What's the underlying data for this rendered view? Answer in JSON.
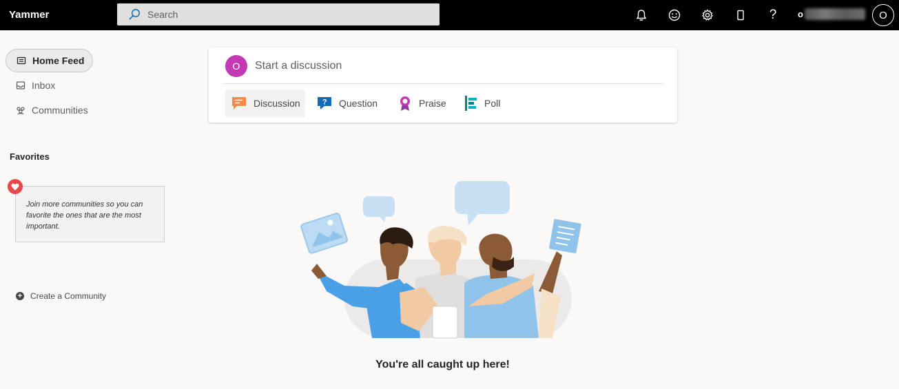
{
  "topbar": {
    "brand": "Yammer",
    "search_placeholder": "Search",
    "icons": [
      "bell-icon",
      "smiley-icon",
      "gear-icon",
      "phone-icon",
      "help-icon"
    ],
    "user_name_visible": "o",
    "avatar_initial": "O"
  },
  "nav": {
    "items": [
      {
        "label": "Home Feed",
        "icon": "home-feed-icon",
        "active": true
      },
      {
        "label": "Inbox",
        "icon": "inbox-icon",
        "active": false
      },
      {
        "label": "Communities",
        "icon": "communities-icon",
        "active": false
      }
    ],
    "favorites_title": "Favorites",
    "favorites_hint": "Join more communities so you can favorite the ones that are the most important.",
    "create_community": "Create a Community"
  },
  "publisher": {
    "avatar_initial": "O",
    "prompt": "Start a discussion",
    "tabs": [
      {
        "label": "Discussion",
        "icon": "discussion-icon",
        "color": "#f7894a",
        "selected": true
      },
      {
        "label": "Question",
        "icon": "question-icon",
        "color": "#0f6cbd"
      },
      {
        "label": "Praise",
        "icon": "praise-icon",
        "color": "#c239b3"
      },
      {
        "label": "Poll",
        "icon": "poll-icon",
        "color": "#038387"
      }
    ]
  },
  "empty_state": {
    "message": "You're all caught up here!"
  },
  "colors": {
    "topbar": "#000000",
    "background": "#faf9f8",
    "avatar": "#c239b3",
    "heart": "#e8484d"
  }
}
